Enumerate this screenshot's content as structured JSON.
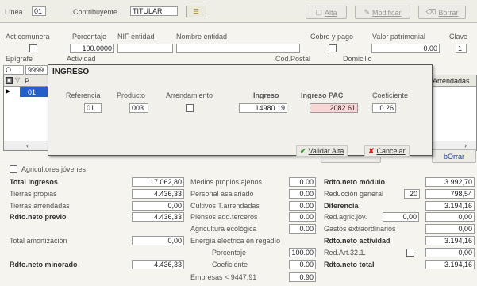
{
  "header": {
    "linea_label": "Línea",
    "linea_value": "01",
    "contribuyente_label": "Contribuyente",
    "contribuyente_value": "TITULAR",
    "alta_label": "Alta",
    "modificar_label": "Modificar",
    "borrar_label": "Borrar"
  },
  "fields": {
    "act_comunera_label": "Act.comunera",
    "porcentaje_label": "Porcentaje",
    "porcentaje_value": "100.0000",
    "nif_label": "NIF entidad",
    "nombre_label": "Nombre entidad",
    "cobro_label": "Cobro y pago",
    "valor_label": "Valor patrimonial",
    "valor_value": "0.00",
    "clave_label": "Clave",
    "clave_value": "1",
    "epigrafe_label": "Epígrafe",
    "epigrafe_value": "O",
    "actividad_label": "Actividad",
    "actividad_value": "9999",
    "codpostal_label": "Cod.Postal",
    "domicilio_label": "Domicilio"
  },
  "grid": {
    "col_p": "P",
    "col_arrendadas": "Arrendadas",
    "row_value": "01"
  },
  "dialog": {
    "title": "INGRESO",
    "referencia_label": "Referencia",
    "referencia_value": "01",
    "producto_label": "Producto",
    "producto_value": "003",
    "arrendamiento_label": "Arrendamiento",
    "ingreso_label": "Ingreso",
    "ingreso_value": "14980.19",
    "ingreso_pac_label": "Ingreso PAC",
    "ingreso_pac_value": "2082.61",
    "coeficiente_label": "Coeficiente",
    "coeficiente_value": "0.26",
    "validar_label": "Validar Alta",
    "cancelar_label": "Cancelar"
  },
  "bottom_buttons": {
    "borrar_label": "bOrrar"
  },
  "summary": {
    "agricultores_label": "Agricultores jóvenes",
    "total_ingresos_label": "Total ingresos",
    "total_ingresos_value": "17.062,80",
    "tierras_propias_label": "Tierras propias",
    "tierras_propias_value": "4.436,33",
    "tierras_arrendadas_label": "Tierras arrendadas",
    "tierras_arrendadas_value": "0,00",
    "rdto_previo_label": "Rdto.neto previo",
    "rdto_previo_value": "4.436,33",
    "total_amort_label": "Total amortización",
    "total_amort_value": "0,00",
    "rdto_minorado_label": "Rdto.neto minorado",
    "rdto_minorado_value": "4.436,33",
    "medios_label": "Medios propios ajenos",
    "medios_value": "0.00",
    "personal_label": "Personal asalariado",
    "personal_value": "0.00",
    "cultivos_label": "Cultivos T.arrendadas",
    "cultivos_value": "0.00",
    "piensos_label": "Piensos adq.terceros",
    "piensos_value": "0.00",
    "agric_eco_label": "Agricultura ecológica",
    "agric_eco_value": "0.00",
    "energia_label": "Energía eléctrica en regadío",
    "porcentaje_label": "Porcentaje",
    "porcentaje_value": "100.00",
    "coeficiente_label": "Coeficiente",
    "coeficiente_value": "0.00",
    "empresas_label": "Empresas < 9447,91",
    "empresas_value": "0.90",
    "rdto_modulo_label": "Rdto.neto módulo",
    "rdto_modulo_value": "3.992,70",
    "reduccion_label": "Reducción general",
    "reduccion_pct": "20",
    "reduccion_value": "798,54",
    "diferencia_label": "Diferencia",
    "diferencia_value": "3.194,16",
    "red_agric_label": "Red.agric.jov.",
    "red_agric_input": "0,00",
    "red_agric_value": "0,00",
    "gastos_extra_label": "Gastos extraordinarios",
    "gastos_extra_value": "0,00",
    "rdto_actividad_label": "Rdto.neto actividad",
    "rdto_actividad_value": "3.194,16",
    "red_art_label": "Red.Art.32.1.",
    "red_art_value": "0,00",
    "rdto_total_label": "Rdto.neto total",
    "rdto_total_value": "3.194,16"
  }
}
